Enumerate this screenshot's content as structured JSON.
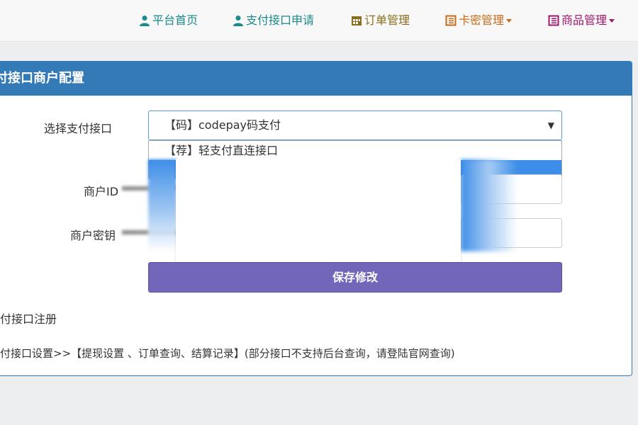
{
  "nav": {
    "items": [
      {
        "label": "平台首页",
        "icon": "user-icon",
        "color": "#1a8a8a"
      },
      {
        "label": "支付接口申请",
        "icon": "user-icon",
        "color": "#1a8a8a"
      },
      {
        "label": "订单管理",
        "icon": "calendar-icon",
        "color": "#8a6d1a"
      },
      {
        "label": "卡密管理",
        "icon": "list-icon",
        "color": "#c96a1a"
      },
      {
        "label": "商品管理",
        "icon": "list-icon",
        "color": "#a0176b"
      }
    ]
  },
  "panel": {
    "title": "付接口商户配置",
    "select_label": "选择支付接口",
    "select_value": "【码】codepay码支付",
    "dropdown_option_1": "【荐】轻支付直连接口",
    "merchant_id_label": "商户ID",
    "merchant_key_label": "商户密钥",
    "save_label": "保存修改",
    "register_text": "付接口注册",
    "settings_text": "付接口设置>>【提现设置 、订单查询、结算记录】(部分接口不支持后台查询，请登陆官网查询)"
  }
}
